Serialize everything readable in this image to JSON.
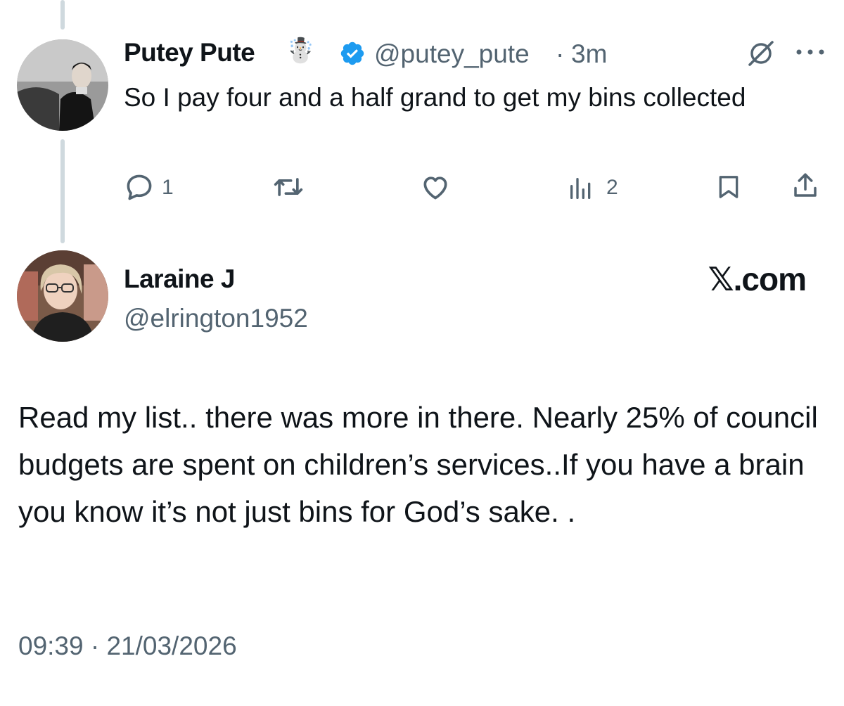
{
  "parent_tweet": {
    "display_name": "Putey Pute",
    "name_emoji": "☃️",
    "handle": "@putey_pute",
    "separator": "·",
    "age": "3m",
    "text": "So I pay four and a half grand to get my bins collected",
    "reply_count": "1",
    "view_count": "2",
    "verified": true,
    "verified_color": "#1d9bf0"
  },
  "reply_tweet": {
    "display_name": "Laraine J",
    "handle": "@elrington1952",
    "text": "Read my list.. there was more in there. Nearly 25% of council budgets are spent on children’s services..If you have a brain you know it’s not just bins for God’s sake. .",
    "timestamp": "09:39 · 21/03/2026"
  },
  "watermark": "𝕏.com",
  "colors": {
    "text": "#0f1419",
    "muted": "#536471",
    "thread_line": "#cfd9de"
  },
  "icons": [
    "grok-icon",
    "more-icon",
    "reply-icon",
    "repost-icon",
    "like-icon",
    "views-icon",
    "bookmark-icon",
    "share-icon"
  ]
}
